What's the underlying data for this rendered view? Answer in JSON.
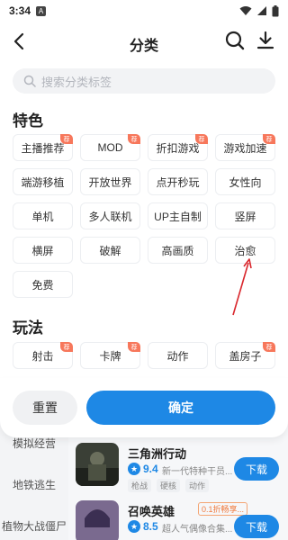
{
  "status": {
    "time": "3:34",
    "notif_letter": "A"
  },
  "header": {
    "title": "分类"
  },
  "search": {
    "placeholder": "搜索分类标签"
  },
  "sections": {
    "featured": {
      "title": "特色",
      "tags": [
        {
          "label": "主播推荐",
          "hot": true
        },
        {
          "label": "MOD",
          "hot": true
        },
        {
          "label": "折扣游戏",
          "hot": true
        },
        {
          "label": "游戏加速",
          "hot": true
        },
        {
          "label": "端游移植",
          "hot": false
        },
        {
          "label": "开放世界",
          "hot": false
        },
        {
          "label": "点开秒玩",
          "hot": false
        },
        {
          "label": "女性向",
          "hot": false
        },
        {
          "label": "单机",
          "hot": false
        },
        {
          "label": "多人联机",
          "hot": false
        },
        {
          "label": "UP主自制",
          "hot": false
        },
        {
          "label": "竖屏",
          "hot": false
        },
        {
          "label": "横屏",
          "hot": false
        },
        {
          "label": "破解",
          "hot": false
        },
        {
          "label": "高画质",
          "hot": false
        },
        {
          "label": "治愈",
          "hot": false
        },
        {
          "label": "免费",
          "hot": false
        }
      ]
    },
    "gameplay": {
      "title": "玩法",
      "tags": [
        {
          "label": "射击",
          "hot": true
        },
        {
          "label": "卡牌",
          "hot": true
        },
        {
          "label": "动作",
          "hot": false
        },
        {
          "label": "盖房子",
          "hot": true
        }
      ]
    }
  },
  "hot_badge": "荐",
  "footer": {
    "reset_label": "重置",
    "confirm_label": "确定"
  },
  "background": {
    "side_items": [
      "模拟经营",
      "地铁逃生",
      "植物大战僵尸"
    ],
    "games": [
      {
        "name": "三角洲行动",
        "rating": "9.4",
        "desc": "新一代特种干员...",
        "chips": [
          "枪战",
          "硬核",
          "动作"
        ],
        "promo": "",
        "download": "下载"
      },
      {
        "name": "召唤英雄",
        "rating": "8.5",
        "desc": "超人气偶像合集...",
        "chips": [],
        "promo": "0.1折畅享...",
        "download": "下载"
      }
    ]
  },
  "colors": {
    "accent": "#1e88e5",
    "badge": "#f7775b",
    "annotation_arrow": "#d9262c"
  }
}
